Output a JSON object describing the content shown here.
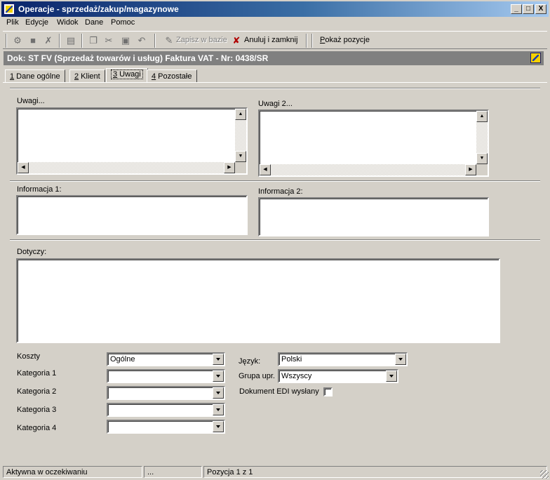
{
  "window": {
    "title": "Operacje - sprzedaż/zakup/magazynowe",
    "icon": "app-icon",
    "controls": {
      "minimize": "_",
      "maximize": "□",
      "close": "X"
    }
  },
  "menu": {
    "items": [
      {
        "label": "Plik"
      },
      {
        "label": "Edycje"
      },
      {
        "label": "Widok"
      },
      {
        "label": "Dane"
      },
      {
        "label": "Pomoc"
      }
    ]
  },
  "toolbar": {
    "icons": [
      "settings-icon",
      "save-icon",
      "delete-icon",
      "properties-icon",
      "copy-icon",
      "cut-icon",
      "paste-icon",
      "undo-icon"
    ],
    "save_label": "Zapisz w bazie",
    "cancel_close_label": "Anuluj i zamknij",
    "show_items_label": "Pokaż pozycje"
  },
  "document": {
    "header": "Dok: ST FV (Sprzedaż towarów i usług)  Faktura VAT  -  Nr: 0438/SR"
  },
  "tabs": [
    {
      "num": "1",
      "label": " Dane ogólne",
      "active": false
    },
    {
      "num": "2",
      "label": " Klient",
      "active": false
    },
    {
      "num": "3",
      "label": " Uwagi",
      "active": true
    },
    {
      "num": "4",
      "label": " Pozostałe",
      "active": false
    }
  ],
  "form": {
    "uwagi_label": "Uwagi...",
    "uwagi2_label": "Uwagi 2...",
    "info1_label": "Informacja 1:",
    "info2_label": "Informacja 2:",
    "dotyczy_label": "Dotyczy:",
    "koszty_label": "Koszty",
    "koszty_value": "Ogólne",
    "kat1_label": "Kategoria 1",
    "kat2_label": "Kategoria 2",
    "kat3_label": "Kategoria 3",
    "kat4_label": "Kategoria 4",
    "jezyk_label": "Język:",
    "jezyk_value": "Polski",
    "grupa_label": "Grupa upr.",
    "grupa_value": "Wszyscy",
    "edi_label": "Dokument EDI wysłany",
    "edi_checked": false
  },
  "statusbar": {
    "state": "Aktywna w oczekiwaniu",
    "middle": "...",
    "position": "Pozycja 1 z 1"
  }
}
